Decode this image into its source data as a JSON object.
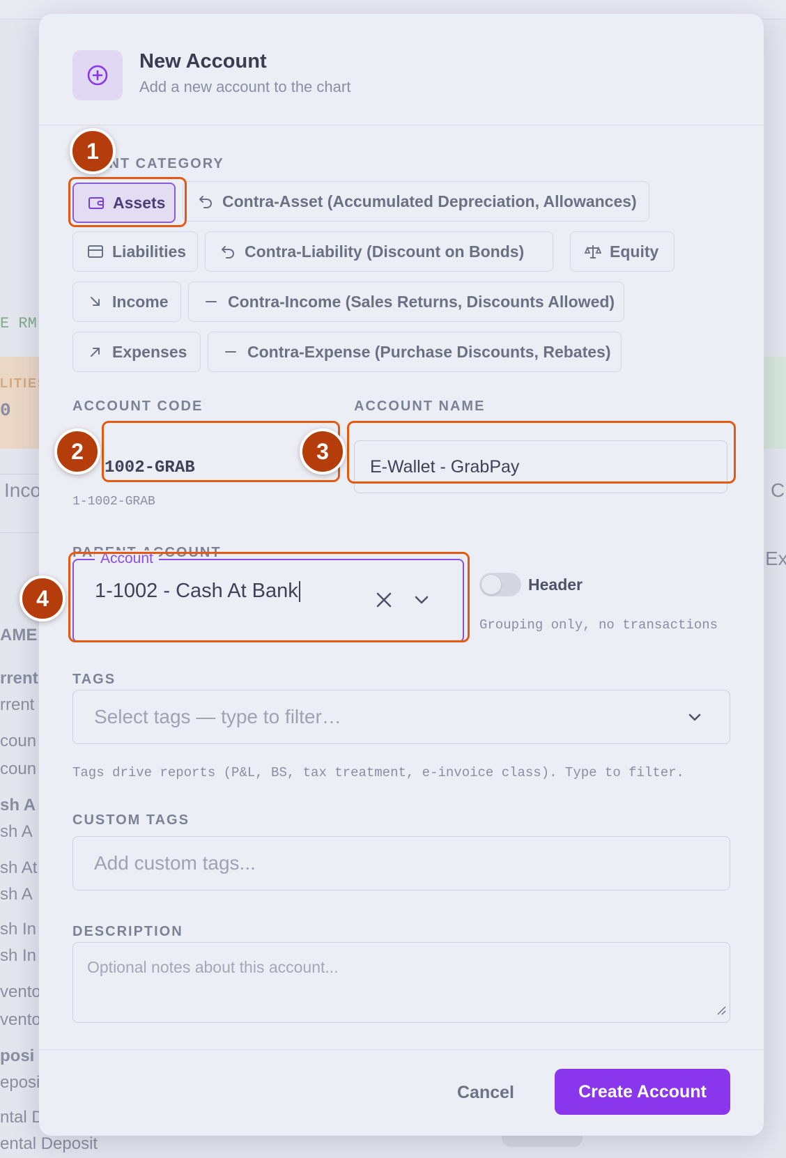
{
  "background": {
    "fragments": {
      "rm": "E RM",
      "lities": "LITIES",
      "zero": "0",
      "inco": "Inco",
      "c": "C",
      "ex": "Ex",
      "ame": "AME",
      "rows": [
        "rrent",
        "rrent",
        "coun",
        "coun",
        "sh A",
        "sh A",
        "sh At",
        "sh A",
        "sh In",
        "sh In",
        "vento",
        "vento",
        "posi",
        "eposi",
        "ntal D",
        "ental Deposit"
      ]
    }
  },
  "modal": {
    "title": "New Account",
    "subtitle": "Add a new account to the chart",
    "header_icon": "plus-circle-icon",
    "account_category": {
      "label": "ACCOUNT CATEGORY",
      "label_visible": "UNT CATEGORY",
      "options": [
        {
          "label": "Assets",
          "icon": "wallet-icon",
          "selected": true
        },
        {
          "label": "Contra-Asset (Accumulated Depreciation, Allowances)",
          "icon": "undo-arrow-icon",
          "selected": false
        },
        {
          "label": "Liabilities",
          "icon": "credit-card-icon",
          "selected": false
        },
        {
          "label": "Contra-Liability (Discount on Bonds)",
          "icon": "undo-arrow-icon",
          "selected": false
        },
        {
          "label": "Equity",
          "icon": "scale-icon",
          "selected": false
        },
        {
          "label": "Income",
          "icon": "arrow-down-right-icon",
          "selected": false
        },
        {
          "label": "Contra-Income (Sales Returns, Discounts Allowed)",
          "icon": "minus-icon",
          "selected": false
        },
        {
          "label": "Expenses",
          "icon": "arrow-up-right-icon",
          "selected": false
        },
        {
          "label": "Contra-Expense (Purchase Discounts, Rebates)",
          "icon": "minus-icon",
          "selected": false
        }
      ]
    },
    "account_code": {
      "label": "ACCOUNT CODE",
      "value": "1002-GRAB",
      "helper": "1-1002-GRAB"
    },
    "account_name": {
      "label": "ACCOUNT NAME",
      "value": "E-Wallet - GrabPay"
    },
    "parent_account": {
      "label": "PARENT ACCOUNT",
      "legend": "Account",
      "value": "1-1002 - Cash At Bank"
    },
    "header_toggle": {
      "label": "Header",
      "helper": "Grouping only, no transactions",
      "on": false
    },
    "tags": {
      "label": "TAGS",
      "placeholder": "Select tags — type to filter…",
      "helper": "Tags drive reports (P&L, BS, tax treatment, e-invoice class). Type to filter."
    },
    "custom_tags": {
      "label": "CUSTOM TAGS",
      "placeholder": "Add custom tags..."
    },
    "description": {
      "label": "DESCRIPTION",
      "placeholder": "Optional notes about this account..."
    },
    "footer": {
      "cancel_label": "Cancel",
      "create_label": "Create Account"
    }
  },
  "annotations": {
    "badges": [
      "1",
      "2",
      "3",
      "4"
    ],
    "highlight_color": "#e45a14",
    "badge_color": "#b53d0c"
  },
  "colors": {
    "accent": "#8a36ec",
    "focus_border": "#8b4fe6"
  }
}
